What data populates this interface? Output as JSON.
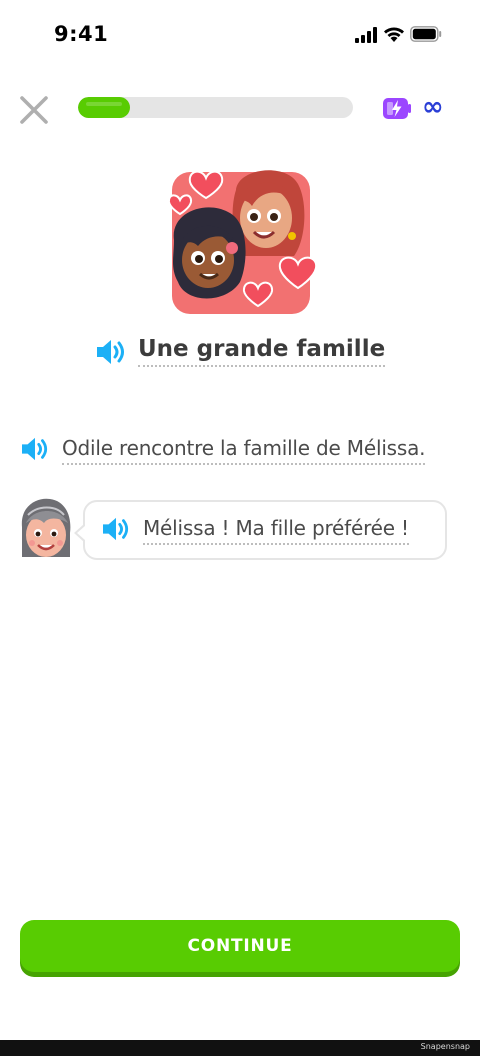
{
  "status_bar": {
    "time": "9:41"
  },
  "lesson": {
    "progress_percent": 19,
    "energy": "∞"
  },
  "story": {
    "title": "Une grande famille",
    "narration": "Odile rencontre la famille de Mélissa.",
    "dialogue": [
      {
        "speaker_avatar": "grandmother",
        "text": "Mélissa ! Ma fille préférée !"
      }
    ]
  },
  "footer": {
    "continue_label": "CONTINUE",
    "watermark": "Snapensnap"
  },
  "colors": {
    "accent_green": "#58cc02",
    "accent_green_shadow": "#46a302",
    "speaker_blue": "#1cb0f6",
    "energy_purple": "#9b46ff",
    "infinity_blue": "#2b3fd6"
  },
  "icons": {
    "close": "close-icon",
    "speaker": "speaker-icon",
    "energy": "energy-battery-icon",
    "signal": "cellular-signal-icon",
    "wifi": "wifi-icon",
    "battery": "battery-icon"
  }
}
